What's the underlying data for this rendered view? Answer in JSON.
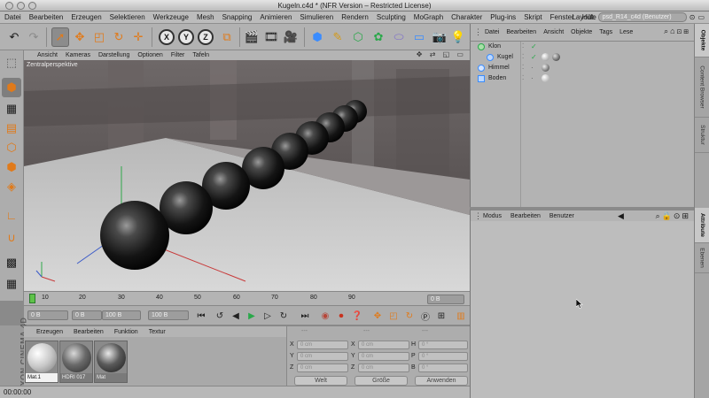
{
  "window": {
    "title": "Kugeln.c4d * (NFR Version – Restricted License)"
  },
  "menubar": {
    "items": [
      "Datei",
      "Bearbeiten",
      "Erzeugen",
      "Selektieren",
      "Werkzeuge",
      "Mesh",
      "Snapping",
      "Animieren",
      "Simulieren",
      "Rendern",
      "Sculpting",
      "MoGraph",
      "Charakter",
      "Plug-ins",
      "Skript",
      "Fenster",
      "Hilfe"
    ],
    "layout_label": "Layout:",
    "layout_value": "psd_R14_c4d (Benutzer)"
  },
  "toolbar": {
    "axis_x": "X",
    "axis_y": "Y",
    "axis_z": "Z"
  },
  "viewport": {
    "menu": [
      "Ansicht",
      "Kameras",
      "Darstellung",
      "Optionen",
      "Filter",
      "Tafeln"
    ],
    "nav_icons": "✥ ⇄ ◱ ▭",
    "label": "Zentralperspektive"
  },
  "timeline": {
    "ticks": [
      "0",
      "10",
      "20",
      "30",
      "40",
      "50",
      "60",
      "70",
      "80",
      "90"
    ],
    "frame_field": "0 B",
    "start_field": "0 B",
    "range_field": "0 B",
    "end_range_field": "100 B",
    "end_field": "100 B"
  },
  "materials": {
    "menu": [
      "Erzeugen",
      "Bearbeiten",
      "Funktion",
      "Textur"
    ],
    "items": [
      {
        "label": "Mat.1",
        "active": true
      },
      {
        "label": "HDRI 017",
        "active": false
      },
      {
        "label": "Mat",
        "active": false
      }
    ]
  },
  "coords": {
    "header": [
      "---",
      "---",
      "---"
    ],
    "rows": [
      {
        "a": "X",
        "av": "0 cm",
        "b": "X",
        "bv": "0 cm",
        "c": "H",
        "cv": "0 °"
      },
      {
        "a": "Y",
        "av": "0 cm",
        "b": "Y",
        "bv": "0 cm",
        "c": "P",
        "cv": "0 °"
      },
      {
        "a": "Z",
        "av": "0 cm",
        "b": "Z",
        "bv": "0 cm",
        "c": "B",
        "cv": "0 °"
      }
    ],
    "mode1": "Welt",
    "mode2": "Größe",
    "apply": "Anwenden"
  },
  "brand": "MAXON CINEMA 4D",
  "status": {
    "time": "00:00:00"
  },
  "object_manager": {
    "menu": [
      "Datei",
      "Bearbeiten",
      "Ansicht",
      "Objekte",
      "Tags",
      "Lese"
    ],
    "objects": [
      {
        "name": "Klon",
        "indent": 0
      },
      {
        "name": "Kugel",
        "indent": 1
      },
      {
        "name": "Himmel",
        "indent": 0
      },
      {
        "name": "Boden",
        "indent": 0
      }
    ]
  },
  "attributes": {
    "menu": [
      "Modus",
      "Bearbeiten",
      "Benutzer"
    ]
  },
  "side_tabs": [
    "Objekte",
    "Content Browser",
    "Struktur",
    "Attribute",
    "Ebenen"
  ],
  "colors": {
    "sphere": "#1e1e1e",
    "floor": "#cfcfcf",
    "accent": "#3a8cff"
  }
}
